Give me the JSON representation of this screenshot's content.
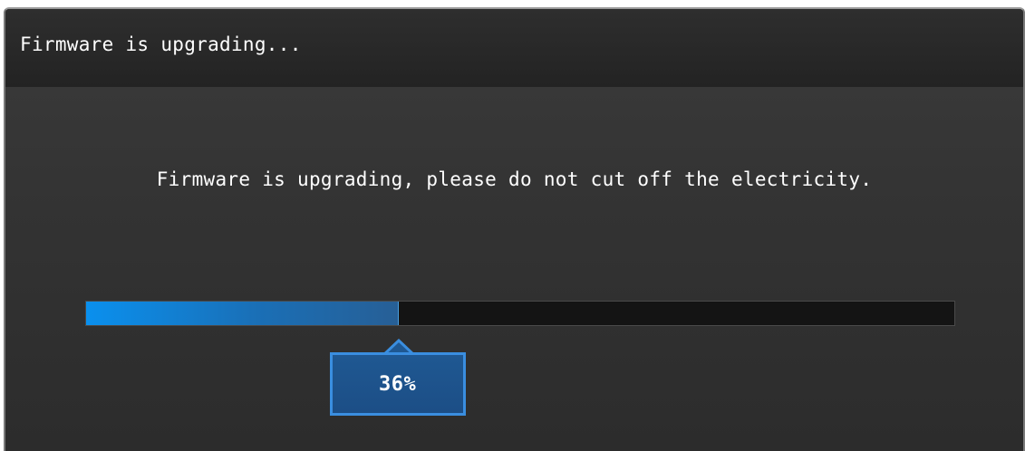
{
  "dialog": {
    "title": "Firmware is upgrading...",
    "message": "Firmware is upgrading, please do not cut off the electricity."
  },
  "progress": {
    "value": 36,
    "label": "36%"
  },
  "colors": {
    "accent": "#0a90ee",
    "bubble_border": "#3a8ee0",
    "bubble_fill": "#1f5892",
    "track": "#141414",
    "dialog_bg": "#333333"
  }
}
